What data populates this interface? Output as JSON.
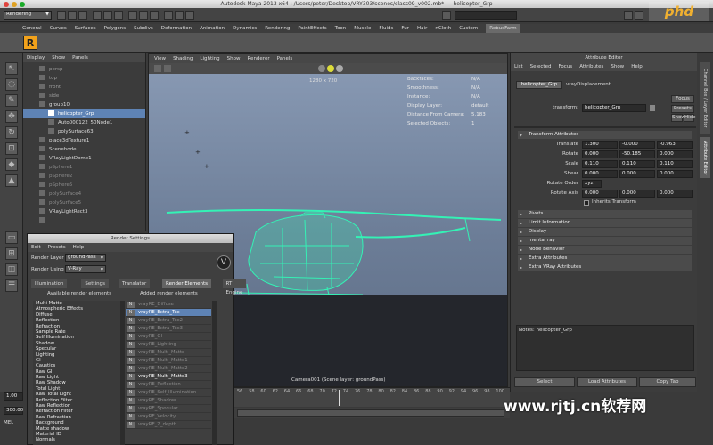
{
  "window": {
    "title": "Autodesk Maya 2013 x64 : /Users/peter/Desktop/VRY303/scenes/class09_v002.mb*  ---  helicopter_Grp"
  },
  "status_line": {
    "mode": "Rendering",
    "logo_text": "phd"
  },
  "shelf": {
    "tabs": [
      "General",
      "Curves",
      "Surfaces",
      "Polygons",
      "Subdivs",
      "Deformation",
      "Animation",
      "Dynamics",
      "Rendering",
      "PaintEffects",
      "Toon",
      "Muscle",
      "Fluids",
      "Fur",
      "Hair",
      "nCloth",
      "Custom",
      "RebusFarm"
    ],
    "active_tab": "RebusFarm",
    "first_icon_glyph": "R"
  },
  "outliner": {
    "menu": [
      "Display",
      "Show",
      "Panels"
    ],
    "items": [
      {
        "label": "persp",
        "selected": false,
        "indent": 0,
        "color": "#9a9a9a"
      },
      {
        "label": "top",
        "selected": false,
        "indent": 0,
        "color": "#9a9a9a"
      },
      {
        "label": "front",
        "selected": false,
        "indent": 0,
        "color": "#9a9a9a"
      },
      {
        "label": "side",
        "selected": false,
        "indent": 0,
        "color": "#9a9a9a"
      },
      {
        "label": "group10",
        "selected": false,
        "indent": 0,
        "color": "#dcdcdc"
      },
      {
        "label": "helicopter_Grp",
        "selected": true,
        "indent": 1,
        "color": "#ffffff"
      },
      {
        "label": "Auto000122_50Node1",
        "selected": false,
        "indent": 1,
        "color": "#dcdcdc"
      },
      {
        "label": "polySurface63",
        "selected": false,
        "indent": 1,
        "color": "#dcdcdc"
      },
      {
        "label": "place3dTexture1",
        "selected": false,
        "indent": 0,
        "color": "#dcdcdc"
      },
      {
        "label": "Scenehode",
        "selected": false,
        "indent": 0,
        "color": "#dcdcdc"
      },
      {
        "label": "VRayLightDome1",
        "selected": false,
        "indent": 0,
        "color": "#dcdcdc"
      },
      {
        "label": "pSphere1",
        "selected": false,
        "indent": 0,
        "color": "#8a8a8a"
      },
      {
        "label": "pSphere2",
        "selected": false,
        "indent": 0,
        "color": "#8a8a8a"
      },
      {
        "label": "pSphere5",
        "selected": false,
        "indent": 0,
        "color": "#8a8a8a"
      },
      {
        "label": "polySurface4",
        "selected": false,
        "indent": 0,
        "color": "#8a8a8a"
      },
      {
        "label": "polySurface5",
        "selected": false,
        "indent": 0,
        "color": "#8a8a8a"
      },
      {
        "label": "VRayLightRect3",
        "selected": false,
        "indent": 0,
        "color": "#dcdcdc"
      },
      {
        "label": "",
        "selected": false,
        "indent": 0,
        "color": "#8a8a8a"
      }
    ]
  },
  "viewport": {
    "menu": [
      "View",
      "Shading",
      "Lighting",
      "Show",
      "Renderer",
      "Panels"
    ],
    "resolution": "1280 x 720",
    "hud": [
      {
        "label": "Backfaces:",
        "value": "N/A"
      },
      {
        "label": "Smoothness:",
        "value": "N/A"
      },
      {
        "label": "Instance:",
        "value": "N/A"
      },
      {
        "label": "Display Layer:",
        "value": "default"
      },
      {
        "label": "Distance From Camera:",
        "value": "5.183"
      },
      {
        "label": "Selected Objects:",
        "value": "1"
      }
    ],
    "camera_label": "Camera001 (Scene layer: groundPass)"
  },
  "attribute_editor": {
    "header": "Attribute Editor",
    "menu": [
      "List",
      "Selected",
      "Focus",
      "Attributes",
      "Show",
      "Help"
    ],
    "tabs": [
      "helicopter_Grp",
      "vrayDisplacement"
    ],
    "transform_label": "transform:",
    "transform_value": "helicopter_Grp",
    "buttons": {
      "focus": "Focus",
      "presets": "Presets",
      "show": "Show",
      "hide": "Hide"
    },
    "section_title": "Transform Attributes",
    "rows": [
      {
        "label": "Translate",
        "values": [
          "1.300",
          "-0.000",
          "-0.963"
        ]
      },
      {
        "label": "Rotate",
        "values": [
          "0.000",
          "-50.185",
          "0.000"
        ]
      },
      {
        "label": "Scale",
        "values": [
          "0.110",
          "0.110",
          "0.110"
        ]
      },
      {
        "label": "Shear",
        "values": [
          "0.000",
          "0.000",
          "0.000"
        ]
      },
      {
        "label": "Rotate Order",
        "values": [
          "xyz"
        ]
      },
      {
        "label": "Rotate Axis",
        "values": [
          "0.000",
          "0.000",
          "0.000"
        ]
      }
    ],
    "inherits_transform": "Inherits Transform",
    "sections": [
      "Pivots",
      "Limit Information",
      "Display",
      "mental ray",
      "Node Behavior",
      "Extra Attributes",
      "Extra VRay Attributes"
    ],
    "notes": "Notes:  helicopter_Grp",
    "bottom_buttons": [
      "Select",
      "Load Attributes",
      "Copy Tab"
    ]
  },
  "side_tabs": [
    "Channel Box / Layer Editor",
    "Attribute Editor"
  ],
  "render_settings": {
    "title": "Render Settings",
    "menu": [
      "Edit",
      "Presets",
      "Help"
    ],
    "render_layer_label": "Render Layer",
    "render_layer_value": "groundPass",
    "render_using_label": "Render Using",
    "render_using_value": "V-Ray",
    "tabs": [
      "Illumination",
      "Settings",
      "Translator",
      "Render Elements",
      "RT Engine"
    ],
    "active_tab": "Render Elements",
    "available_title": "Available render elements",
    "added_title": "Added render elements",
    "available": [
      "Multi Matte",
      "Atmospheric Effects",
      "Diffuse",
      "Reflection",
      "Refraction",
      "Sample Rate",
      "Self Illumination",
      "Shadow",
      "Specular",
      "Lighting",
      "GI",
      "Caustics",
      "Raw GI",
      "Raw Light",
      "Raw Shadow",
      "Total Light",
      "Raw Total Light",
      "Reflection Filter",
      "Raw Reflection",
      "Refraction Filter",
      "Raw Refraction",
      "Background",
      "Matte shadow",
      "Material ID",
      "Normals"
    ],
    "added": [
      {
        "label": "vrayRE_Diffuse",
        "selected": false,
        "hi": false
      },
      {
        "label": "vrayRE_Extra_Tex",
        "selected": true,
        "hi": false
      },
      {
        "label": "vrayRE_Extra_Tex2",
        "selected": false,
        "hi": false
      },
      {
        "label": "vrayRE_Extra_Tex3",
        "selected": false,
        "hi": false
      },
      {
        "label": "vrayRE_GI",
        "selected": false,
        "hi": false
      },
      {
        "label": "vrayRE_Lighting",
        "selected": false,
        "hi": false
      },
      {
        "label": "vrayRE_Multi_Matte",
        "selected": false,
        "hi": false
      },
      {
        "label": "vrayRE_Multi_Matte1",
        "selected": false,
        "hi": false
      },
      {
        "label": "vrayRE_Multi_Matte2",
        "selected": false,
        "hi": false
      },
      {
        "label": "vrayRE_Multi_Matte3",
        "selected": false,
        "hi": true
      },
      {
        "label": "vrayRE_Reflection",
        "selected": false,
        "hi": false
      },
      {
        "label": "vrayRE_Self_Illumination",
        "selected": false,
        "hi": false
      },
      {
        "label": "vrayRE_Shadow",
        "selected": false,
        "hi": false
      },
      {
        "label": "vrayRE_Specular",
        "selected": false,
        "hi": false
      },
      {
        "label": "vrayRE_Velocity",
        "selected": false,
        "hi": false
      },
      {
        "label": "vrayRE_Z_depth",
        "selected": false,
        "hi": false
      }
    ]
  },
  "timeline": {
    "ticks": [
      "56",
      "58",
      "60",
      "62",
      "64",
      "66",
      "68",
      "70",
      "72",
      "74",
      "76",
      "78",
      "80",
      "82",
      "84",
      "86",
      "88",
      "90",
      "92",
      "94",
      "96",
      "98",
      "100"
    ],
    "current_frame": "1.00",
    "range_start": "1.00",
    "range_end": "300.00",
    "cmd_label": "MEL"
  },
  "watermark": "www.rjtj.cn软荐网"
}
